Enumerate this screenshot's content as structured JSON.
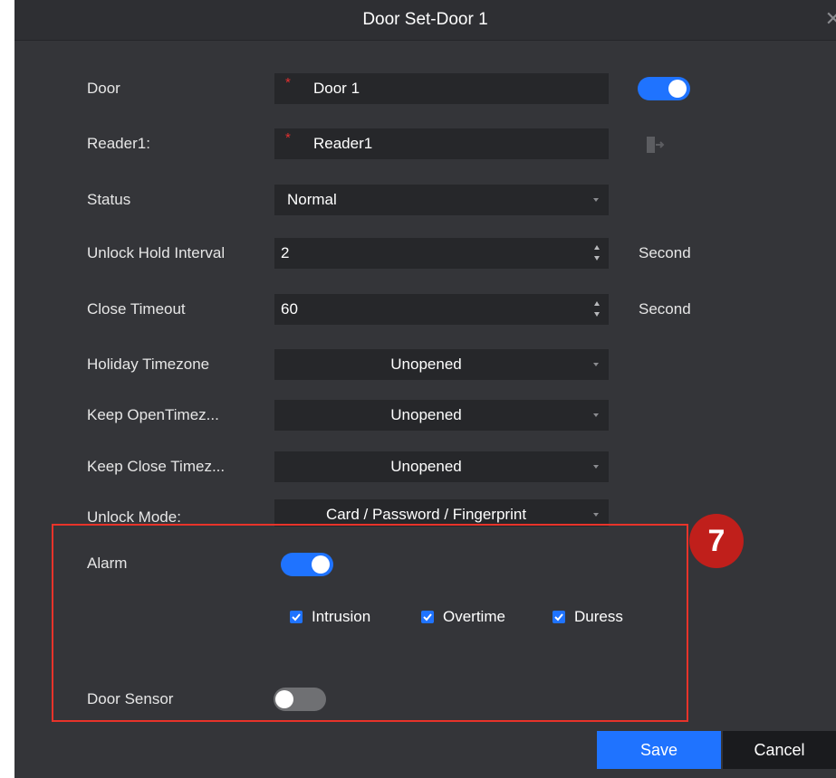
{
  "dialog": {
    "title": "Door Set-Door 1"
  },
  "fields": {
    "door": {
      "label": "Door",
      "required_mark": "*",
      "value": "Door 1",
      "toggle_on": true
    },
    "reader": {
      "label": "Reader1:",
      "required_mark": "*",
      "value": "Reader1",
      "icon": "door-exit-icon"
    },
    "status": {
      "label": "Status",
      "value": "Normal"
    },
    "unlock_hold": {
      "label": "Unlock Hold Interval",
      "value": "2",
      "unit": "Second"
    },
    "close_timeout": {
      "label": "Close Timeout",
      "value": "60",
      "unit": "Second"
    },
    "holiday_timezone": {
      "label": "Holiday Timezone",
      "value": "Unopened"
    },
    "keep_open": {
      "label": "Keep OpenTimez...",
      "value": "Unopened"
    },
    "keep_close": {
      "label": "Keep Close Timez...",
      "value": "Unopened"
    },
    "unlock_mode": {
      "label": "Unlock Mode:",
      "value": "Card / Password / Fingerprint"
    }
  },
  "alarm": {
    "label": "Alarm",
    "toggle_on": true,
    "options": [
      {
        "label": "Intrusion",
        "checked": true
      },
      {
        "label": "Overtime",
        "checked": true
      },
      {
        "label": "Duress",
        "checked": true
      }
    ]
  },
  "door_sensor": {
    "label": "Door Sensor",
    "toggle_on": false
  },
  "step_badge": "7",
  "buttons": {
    "save": "Save",
    "cancel": "Cancel"
  },
  "colors": {
    "accent": "#1f73ff",
    "highlight": "#e8332a",
    "badge": "#c01f1b",
    "background": "#343539"
  }
}
